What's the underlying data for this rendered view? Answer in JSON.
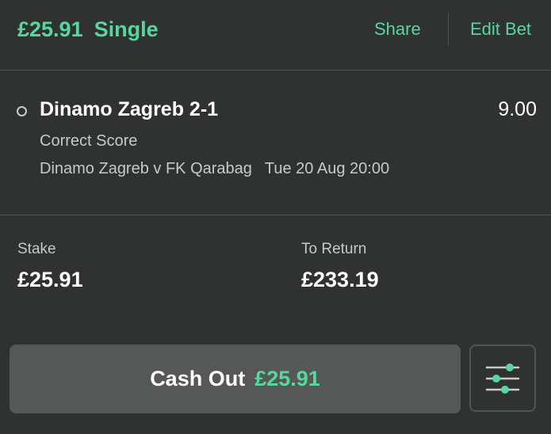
{
  "header": {
    "amount": "£25.91",
    "bet_type": "Single",
    "share_label": "Share",
    "edit_label": "Edit Bet"
  },
  "selection": {
    "name": "Dinamo Zagreb 2-1",
    "odds": "9.00",
    "market": "Correct Score",
    "event": "Dinamo Zagreb v FK Qarabag",
    "datetime": "Tue 20 Aug 20:00"
  },
  "summary": {
    "stake_label": "Stake",
    "stake_value": "£25.91",
    "return_label": "To Return",
    "return_value": "£233.19"
  },
  "cashout": {
    "label": "Cash Out",
    "amount": "£25.91"
  },
  "icons": {
    "settings": "sliders-icon",
    "selection_marker": "radio-circle-icon"
  },
  "colors": {
    "accent": "#58d6a0",
    "background": "#2f3230",
    "button": "#555856"
  }
}
